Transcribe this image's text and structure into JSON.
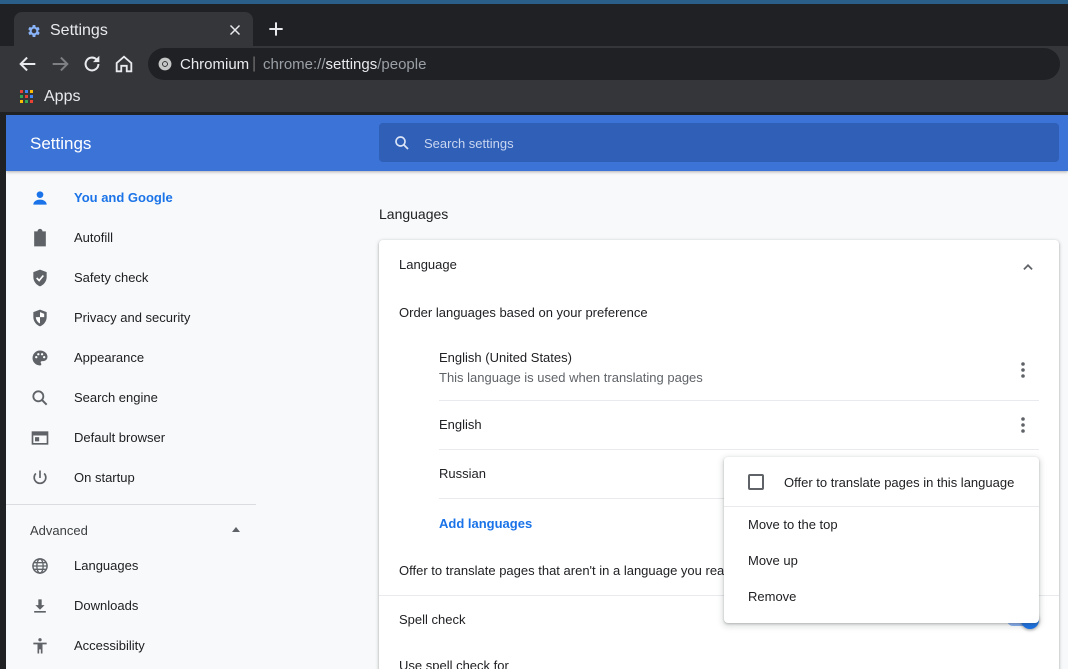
{
  "browser": {
    "tab": {
      "title": "Settings"
    },
    "omnibox": {
      "site": "Chromium",
      "separator": "|",
      "url_prefix": "chrome://",
      "url_host": "settings",
      "url_path": "/people"
    },
    "bookmarks": {
      "apps_label": "Apps"
    }
  },
  "header": {
    "title": "Settings",
    "search_placeholder": "Search settings"
  },
  "sidebar": {
    "items": [
      {
        "label": "You and Google",
        "icon": "person-icon"
      },
      {
        "label": "Autofill",
        "icon": "clipboard-icon"
      },
      {
        "label": "Safety check",
        "icon": "shield-check-icon"
      },
      {
        "label": "Privacy and security",
        "icon": "shield-icon"
      },
      {
        "label": "Appearance",
        "icon": "palette-icon"
      },
      {
        "label": "Search engine",
        "icon": "search-icon"
      },
      {
        "label": "Default browser",
        "icon": "browser-icon"
      },
      {
        "label": "On startup",
        "icon": "power-icon"
      }
    ],
    "advanced_label": "Advanced",
    "advanced_items": [
      {
        "label": "Languages",
        "icon": "globe-icon"
      },
      {
        "label": "Downloads",
        "icon": "download-icon"
      },
      {
        "label": "Accessibility",
        "icon": "accessibility-icon"
      }
    ]
  },
  "main": {
    "section_title": "Languages",
    "language_header": "Language",
    "order_label": "Order languages based on your preference",
    "languages": [
      {
        "name": "English (United States)",
        "sub": "This language is used when translating pages"
      },
      {
        "name": "English"
      },
      {
        "name": "Russian"
      }
    ],
    "add_languages": "Add languages",
    "offer_translate_label": "Offer to translate pages that aren't in a language you read",
    "spell_check_label": "Spell check",
    "use_spell_check_label": "Use spell check for"
  },
  "context_menu": {
    "checkbox_label": "Offer to translate pages in this language",
    "items": [
      "Move to the top",
      "Move up",
      "Remove"
    ]
  },
  "colors": {
    "accent": "#1a73e8",
    "header_blue": "#3b73d6"
  }
}
